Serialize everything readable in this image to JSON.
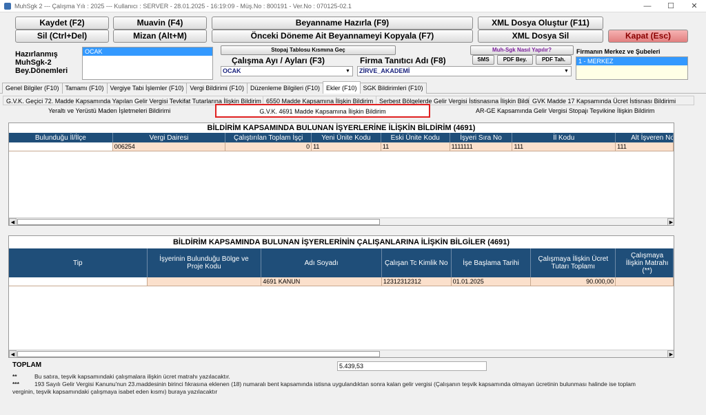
{
  "titlebar": {
    "text": "MuhSgk 2  ---  Çalışma Yılı : 2025  ---  Kullanıcı : SERVER - 28.01.2025 - 16:19:09 - Müş.No : 800191 - Ver.No : 070125-02.1",
    "minimize": "—",
    "maximize": "☐",
    "close": "✕"
  },
  "toolbar": {
    "kaydet": "Kaydet (F2)",
    "muavin": "Muavin (F4)",
    "beyanname": "Beyanname Hazırla (F9)",
    "xml_olustur": "XML Dosya Oluştur (F11)",
    "sil": "Sil (Ctrl+Del)",
    "mizan": "Mizan (Alt+M)",
    "onceki": "Önceki Döneme Ait Beyannameyi Kopyala (F7)",
    "xml_sil": "XML Dosya Sil",
    "kapat": "Kapat (Esc)",
    "stopaj": "Stopaj Tablosu Kısmına Geç",
    "nasil": "Muh-Sgk Nasıl Yapılır?",
    "sms": "SMS",
    "pdf_bey": "PDF Bey.",
    "pdf_tah": "PDF Tah."
  },
  "left": {
    "label_lines": [
      "Hazırlanmış",
      "MuhSgk-2",
      "Bey.Dönemleri"
    ],
    "periods": [
      "OCAK"
    ]
  },
  "calisma": {
    "label": "Çalışma Ayı / Ayları (F3)",
    "value": "OCAK"
  },
  "firma": {
    "label": "Firma Tanıtıcı Adı (F8)",
    "value": "ZİRVE_AKADEMİ"
  },
  "subeler": {
    "label": "Firmanın Merkez ve Şubeleri",
    "items": [
      "1 - MERKEZ"
    ]
  },
  "tabs": [
    "Genel Bilgiler (F10)",
    "Tamamı (F10)",
    "Vergiye Tabi İşlemler (F10)",
    "Vergi Bildirimi (F10)",
    "Düzenleme Bilgileri (F10)",
    "Ekler (F10)",
    "SGK Bildirimleri (F10)"
  ],
  "subtabs_row1": [
    "G.V.K. Geçici 72. Madde Kapsamında Yapılan Gelir Vergisi Tevkifat Tutarlarına İlişkin Bildirim",
    "6550 Madde Kapsamına İlişkin Bildirim",
    "Serbest Bölgelerde Gelir Vergisi İstisnasına İlişkin Bildirimler",
    "GVK Madde 17 Kapsamında Ücret İstisnası Bildirimi"
  ],
  "subtabs_row2": [
    "Yeraltı ve Yerüstü Maden İşletmeleri Bildirimi",
    "G.V.K. 4691 Madde Kapsamına İlişkin Bildirim",
    "AR-GE Kapsamında Gelir Vergisi Stopajı Teşvikine İlişkin Bildirim"
  ],
  "table1": {
    "title": "BİLDİRİM KAPSAMINDA BULUNAN İŞYERLERİNE İLİŞKİN BİLDİRİM (4691)",
    "headers": [
      "Bulunduğu İl/İlçe",
      "Vergi Dairesi",
      "Çalıştırılan Toplam İşçi",
      "Yeni Ünite Kodu",
      "Eski Ünite Kodu",
      "İşyeri Sıra No",
      "İl Kodu",
      "Alt İşveren No"
    ],
    "row": [
      "",
      "006254",
      "0",
      "11",
      "11",
      "1111111",
      "111",
      "111"
    ]
  },
  "table2": {
    "title": "BİLDİRİM KAPSAMINDA BULUNAN İŞYERLERİNİN ÇALIŞANLARINA İLİŞKİN BİLGİLER (4691)",
    "headers": [
      "Tip",
      "İşyerinin Bulunduğu Bölge ve Proje Kodu",
      "Adı Soyadı",
      "Çalışan Tc Kimlik No",
      "İşe Başlama Tarihi",
      "Çalışmaya İlişkin Ücret Tutarı Toplamı",
      "Çalışmaya İlişkin Matrahı (**)"
    ],
    "row": [
      "",
      "",
      "4691 KANUN",
      "12312312312",
      "01.01.2025",
      "90.000,00",
      ""
    ]
  },
  "total": {
    "label": "TOPLAM",
    "value": "5.439,53"
  },
  "notes": [
    {
      "mark": "**",
      "text": "Bu satıra, teşvik kapsamındaki çalışmalara ilişkin ücret matrahı yazılacaktır."
    },
    {
      "mark": "***",
      "text": "193 Sayılı Gelir Vergisi Kanunu'nun 23.maddesinin birinci fıkrasına eklenen (18) numaralı bent kapsamında istisna uygulandıktan sonra kalan gelir vergisi (Çalışanın teşvik kapsamında olmayan ücretinin bulunması halinde ise toplam"
    },
    {
      "mark": "",
      "text": "verginin, teşvik kapsamındaki çalışmaya isabet eden kısmı) buraya yazılacaktır"
    }
  ]
}
